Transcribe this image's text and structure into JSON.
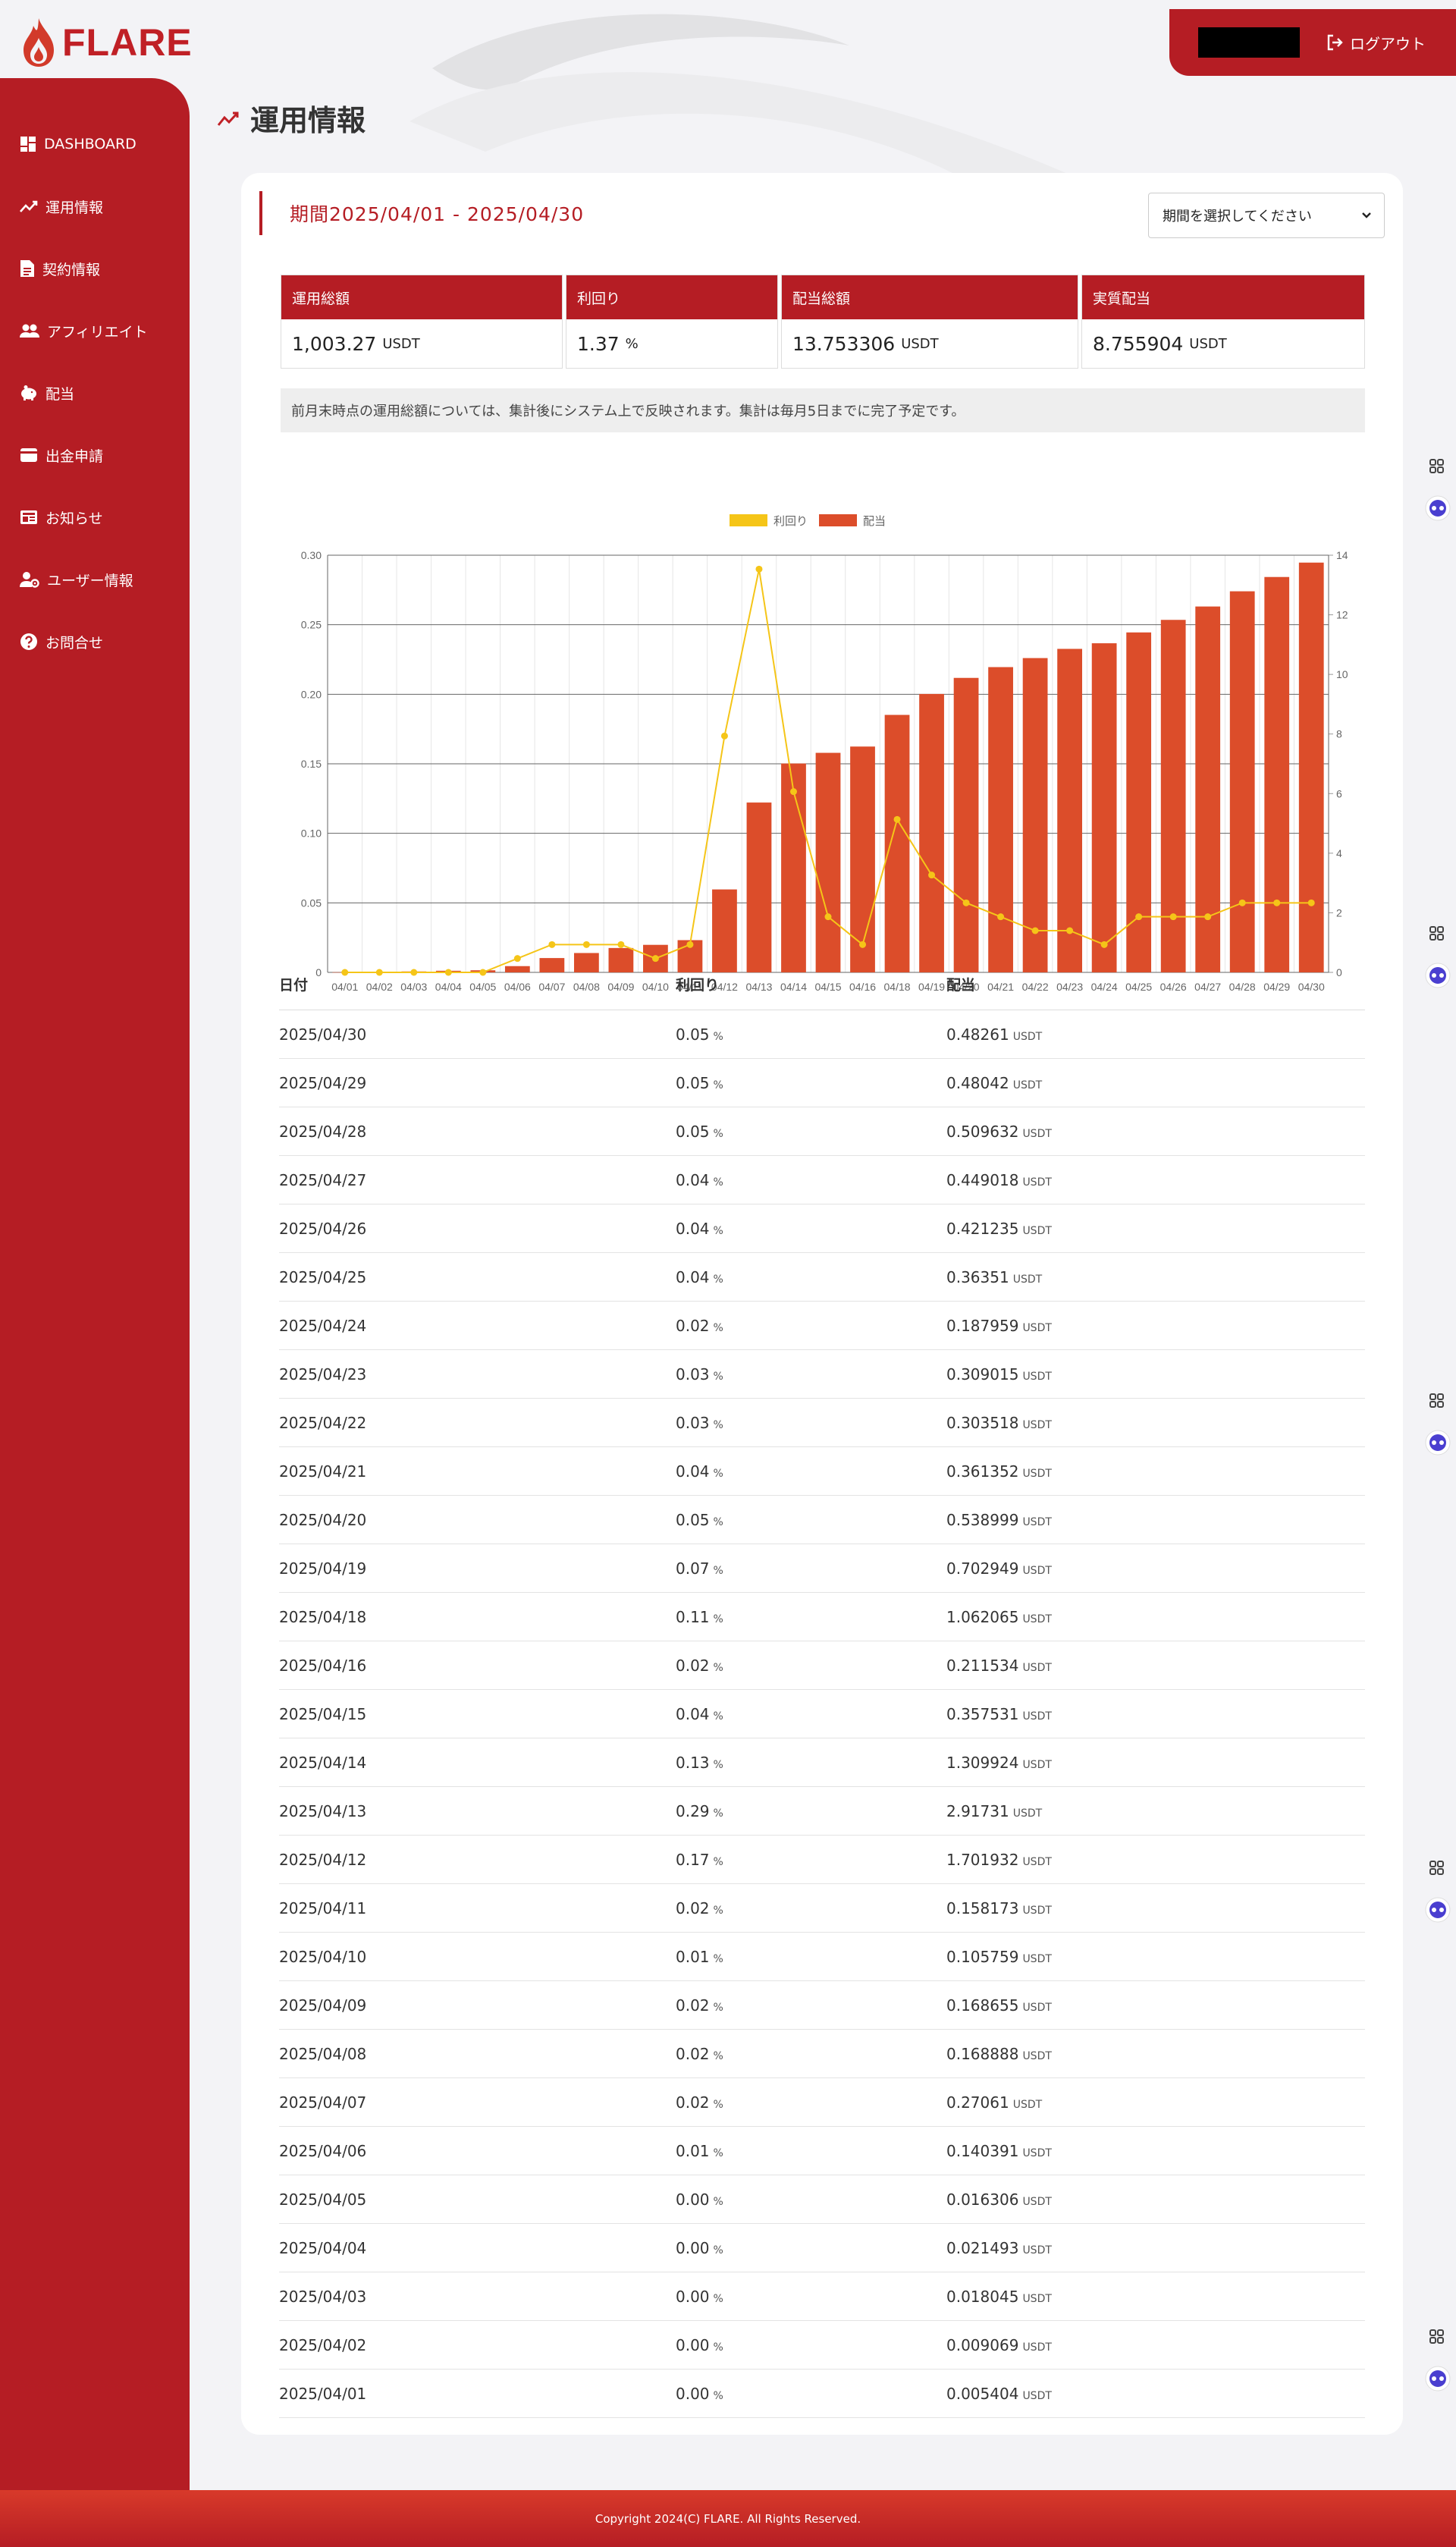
{
  "app": {
    "logo_text": "FLARE"
  },
  "header": {
    "logout_label": "ログアウト"
  },
  "sidebar": {
    "items": [
      {
        "label": "DASHBOARD",
        "icon": "dashboard-icon"
      },
      {
        "label": "運用情報",
        "icon": "trend-icon"
      },
      {
        "label": "契約情報",
        "icon": "document-icon"
      },
      {
        "label": "アフィリエイト",
        "icon": "users-icon"
      },
      {
        "label": "配当",
        "icon": "piggy-bank-icon"
      },
      {
        "label": "出金申請",
        "icon": "wallet-icon"
      },
      {
        "label": "お知らせ",
        "icon": "news-icon"
      },
      {
        "label": "ユーザー情報",
        "icon": "user-gear-icon"
      },
      {
        "label": "お問合せ",
        "icon": "question-icon"
      }
    ]
  },
  "page": {
    "title": "運用情報"
  },
  "period": {
    "label": "期間2025/04/01 - 2025/04/30",
    "select_placeholder": "期間を選択してください"
  },
  "stats": [
    {
      "label": "運用総額",
      "value": "1,003.27",
      "unit": "USDT"
    },
    {
      "label": "利回り",
      "value": "1.37",
      "unit": "%"
    },
    {
      "label": "配当総額",
      "value": "13.753306",
      "unit": "USDT"
    },
    {
      "label": "実質配当",
      "value": "8.755904",
      "unit": "USDT"
    }
  ],
  "notice": "前月末時点の運用総額については、集計後にシステム上で反映されます。集計は毎月5日までに完了予定です。",
  "chart_data": {
    "type": "bar",
    "categories": [
      "04/01",
      "04/02",
      "04/03",
      "04/04",
      "04/05",
      "04/06",
      "04/07",
      "04/08",
      "04/09",
      "04/10",
      "04/11",
      "04/12",
      "04/13",
      "04/14",
      "04/15",
      "04/16",
      "04/18",
      "04/19",
      "04/20",
      "04/21",
      "04/22",
      "04/23",
      "04/24",
      "04/25",
      "04/26",
      "04/27",
      "04/28",
      "04/29",
      "04/30"
    ],
    "series": [
      {
        "name": "利回り",
        "type": "line",
        "axis": "left",
        "color": "#f5c518",
        "values": [
          0.0,
          0.0,
          0.0,
          0.0,
          0.0,
          0.01,
          0.02,
          0.02,
          0.02,
          0.01,
          0.02,
          0.17,
          0.29,
          0.13,
          0.04,
          0.02,
          0.11,
          0.07,
          0.05,
          0.04,
          0.03,
          0.03,
          0.02,
          0.04,
          0.04,
          0.04,
          0.05,
          0.05,
          0.05
        ]
      },
      {
        "name": "配当",
        "type": "bar",
        "axis": "right",
        "color": "#dc4d2a",
        "values": [
          0.005,
          0.014,
          0.032,
          0.054,
          0.07,
          0.21,
          0.481,
          0.65,
          0.818,
          0.924,
          1.082,
          2.784,
          5.7,
          7.01,
          7.368,
          7.579,
          8.641,
          9.344,
          9.883,
          10.245,
          10.548,
          10.857,
          11.045,
          11.409,
          11.83,
          12.279,
          12.789,
          13.269,
          13.752
        ]
      }
    ],
    "ylim_left": [
      0,
      0.3
    ],
    "yticks_left": [
      "0",
      "0.05",
      "0.10",
      "0.15",
      "0.20",
      "0.25",
      "0.30"
    ],
    "ylim_right": [
      0,
      14
    ],
    "yticks_right": [
      "0",
      "2",
      "4",
      "6",
      "8",
      "10",
      "12",
      "14"
    ],
    "legend": "top-center",
    "grid": true
  },
  "table": {
    "headers": [
      "日付",
      "利回り",
      "配当"
    ],
    "pct_unit": "%",
    "usdt_unit": "USDT",
    "rows": [
      [
        "2025/04/30",
        "0.05",
        "0.48261"
      ],
      [
        "2025/04/29",
        "0.05",
        "0.48042"
      ],
      [
        "2025/04/28",
        "0.05",
        "0.509632"
      ],
      [
        "2025/04/27",
        "0.04",
        "0.449018"
      ],
      [
        "2025/04/26",
        "0.04",
        "0.421235"
      ],
      [
        "2025/04/25",
        "0.04",
        "0.36351"
      ],
      [
        "2025/04/24",
        "0.02",
        "0.187959"
      ],
      [
        "2025/04/23",
        "0.03",
        "0.309015"
      ],
      [
        "2025/04/22",
        "0.03",
        "0.303518"
      ],
      [
        "2025/04/21",
        "0.04",
        "0.361352"
      ],
      [
        "2025/04/20",
        "0.05",
        "0.538999"
      ],
      [
        "2025/04/19",
        "0.07",
        "0.702949"
      ],
      [
        "2025/04/18",
        "0.11",
        "1.062065"
      ],
      [
        "2025/04/16",
        "0.02",
        "0.211534"
      ],
      [
        "2025/04/15",
        "0.04",
        "0.357531"
      ],
      [
        "2025/04/14",
        "0.13",
        "1.309924"
      ],
      [
        "2025/04/13",
        "0.29",
        "2.91731"
      ],
      [
        "2025/04/12",
        "0.17",
        "1.701932"
      ],
      [
        "2025/04/11",
        "0.02",
        "0.158173"
      ],
      [
        "2025/04/10",
        "0.01",
        "0.105759"
      ],
      [
        "2025/04/09",
        "0.02",
        "0.168655"
      ],
      [
        "2025/04/08",
        "0.02",
        "0.168888"
      ],
      [
        "2025/04/07",
        "0.02",
        "0.27061"
      ],
      [
        "2025/04/06",
        "0.01",
        "0.140391"
      ],
      [
        "2025/04/05",
        "0.00",
        "0.016306"
      ],
      [
        "2025/04/04",
        "0.00",
        "0.021493"
      ],
      [
        "2025/04/03",
        "0.00",
        "0.018045"
      ],
      [
        "2025/04/02",
        "0.00",
        "0.009069"
      ],
      [
        "2025/04/01",
        "0.00",
        "0.005404"
      ]
    ]
  },
  "footer": {
    "copyright": "Copyright 2024(C) FLARE. All Rights Reserved."
  },
  "colors": {
    "brand": "#b51d24",
    "bar": "#dc4d2a",
    "line": "#f5c518",
    "background": "#f3f3f6"
  }
}
